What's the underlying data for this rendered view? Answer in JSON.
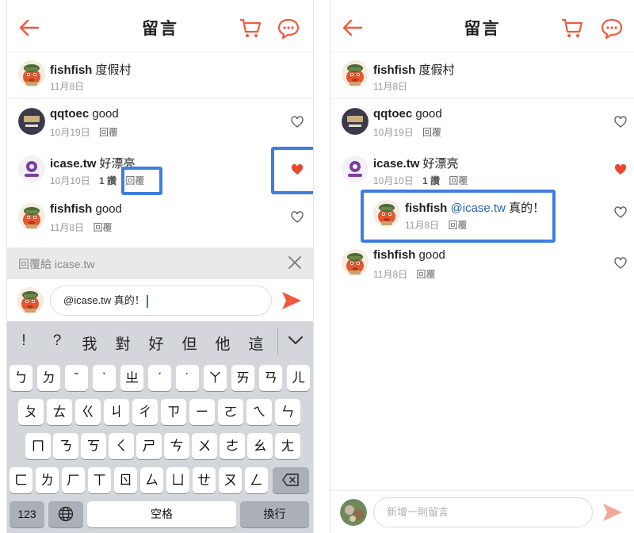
{
  "left": {
    "header": {
      "title": "留言"
    },
    "comments": [
      {
        "name": "fishfish",
        "text": "度假村",
        "date": "11月8日"
      },
      {
        "name": "qqtoec",
        "text": "good",
        "date": "10月19日",
        "reply": "回覆"
      },
      {
        "name": "icase.tw",
        "text": "好漂亮",
        "date": "10月10日",
        "likes": "1 讚",
        "reply": "回覆"
      },
      {
        "name": "fishfish",
        "text": "good",
        "date": "11月8日",
        "reply": "回覆"
      }
    ],
    "reply_bar": {
      "label": "回覆給 icase.tw"
    },
    "input": {
      "value": "@icase.tw 真的！"
    },
    "keyboard": {
      "suggestions": [
        "!",
        "?",
        "我",
        "對",
        "好",
        "但",
        "他",
        "這"
      ],
      "row1": [
        "ㄅ",
        "ㄉ",
        "ˇ",
        "ˋ",
        "ㄓ",
        "ˊ",
        "˙",
        "ㄚ",
        "ㄞ",
        "ㄢ",
        "ㄦ"
      ],
      "row2": [
        "ㄆ",
        "ㄊ",
        "ㄍ",
        "ㄐ",
        "ㄔ",
        "ㄗ",
        "ㄧ",
        "ㄛ",
        "ㄟ",
        "ㄣ"
      ],
      "row3": [
        "ㄇ",
        "ㄋ",
        "ㄎ",
        "ㄑ",
        "ㄕ",
        "ㄘ",
        "ㄨ",
        "ㄜ",
        "ㄠ",
        "ㄤ"
      ],
      "row4": [
        "ㄈ",
        "ㄌ",
        "ㄏ",
        "ㄒ",
        "ㄖ",
        "ㄙ",
        "ㄩ",
        "ㄝ",
        "ㄡ",
        "ㄥ"
      ],
      "num_key": "123",
      "space_key": "空格",
      "return_key": "換行"
    }
  },
  "right": {
    "header": {
      "title": "留言"
    },
    "comments": [
      {
        "name": "fishfish",
        "text": "度假村",
        "date": "11月8日"
      },
      {
        "name": "qqtoec",
        "text": "good",
        "date": "10月19日",
        "reply": "回覆"
      },
      {
        "name": "icase.tw",
        "text": "好漂亮",
        "date": "10月10日",
        "likes": "1 讚",
        "reply": "回覆"
      },
      {
        "name": "fishfish",
        "mention": "@icase.tw",
        "text": "真的！",
        "date": "11月8日",
        "reply": "回覆"
      },
      {
        "name": "fishfish",
        "text": "good",
        "date": "11月8日",
        "reply": "回覆"
      }
    ],
    "input": {
      "placeholder": "新增一則留言"
    }
  },
  "colors": {
    "accent": "#ef5a3c",
    "highlight": "#3f7de0",
    "liked": "#e8472c",
    "mention": "#2a62b8"
  },
  "icons": [
    "back-arrow-icon",
    "cart-icon",
    "chat-bubble-icon",
    "heart-icon",
    "close-icon",
    "send-icon",
    "globe-icon",
    "backspace-icon",
    "chevron-down-icon"
  ]
}
